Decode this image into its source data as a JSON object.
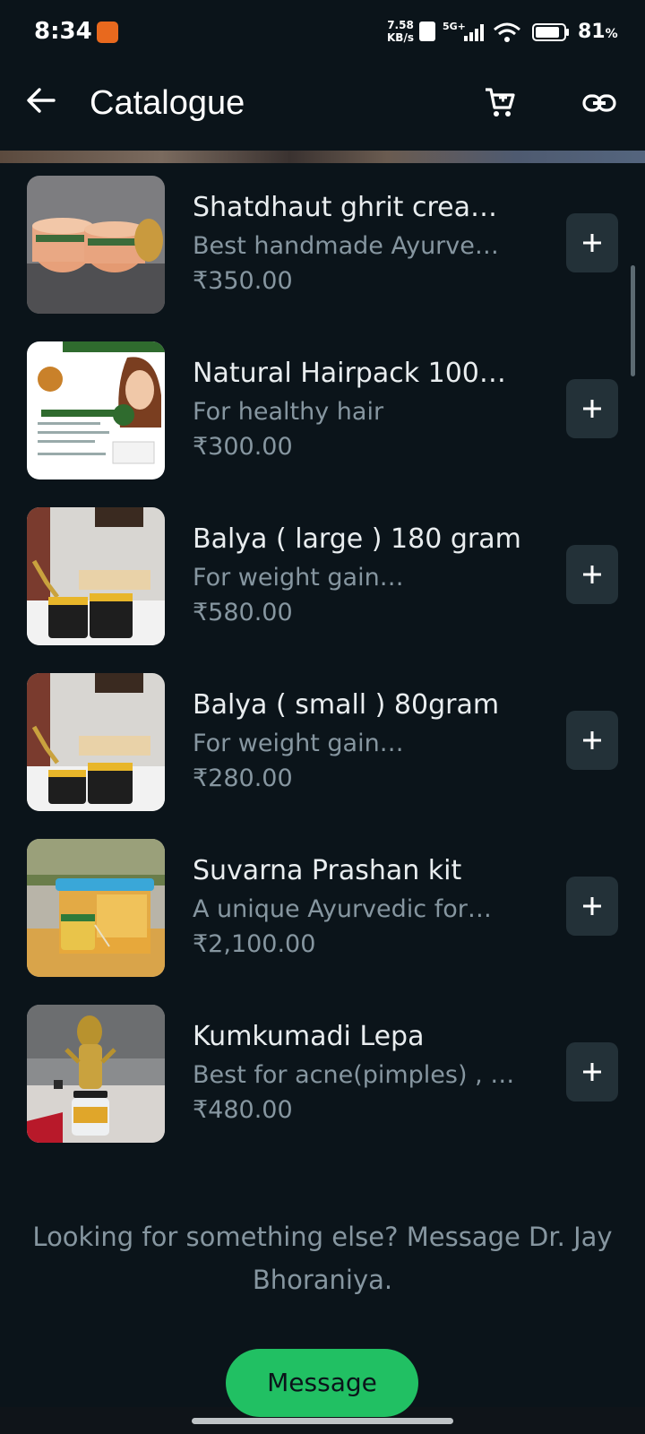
{
  "status_bar": {
    "time": "8:34",
    "net_speed_value": "7.58",
    "net_speed_unit": "KB/s",
    "network": "5G+",
    "battery_percent": "81",
    "battery_unit": "%"
  },
  "header": {
    "title": "Catalogue",
    "icons": [
      "back-arrow-icon",
      "cart-icon",
      "link-icon"
    ]
  },
  "products": [
    {
      "name": "Shatdhaut ghrit crea…",
      "description": "Best handmade Ayurve…",
      "price": "₹350.00",
      "add_label": "+"
    },
    {
      "name": "Natural Hairpack 100…",
      "description": "For healthy hair",
      "price": "₹300.00",
      "add_label": "+"
    },
    {
      "name": "Balya ( large ) 180 gram",
      "description": "For weight gain…",
      "price": "₹580.00",
      "add_label": "+"
    },
    {
      "name": "Balya ( small ) 80gram",
      "description": "For weight gain…",
      "price": "₹280.00",
      "add_label": "+"
    },
    {
      "name": "Suvarna Prashan kit",
      "description": "A unique Ayurvedic for…",
      "price": "₹2,100.00",
      "add_label": "+"
    },
    {
      "name": "Kumkumadi Lepa",
      "description": "Best for acne(pimples) , …",
      "price": "₹480.00",
      "add_label": "+"
    }
  ],
  "footer": {
    "prompt": "Looking for something else? Message Dr. Jay Bhoraniya.",
    "message_button": "Message"
  },
  "colors": {
    "background": "#0b141a",
    "accent": "#21c063",
    "secondary_text": "#8696a0",
    "add_button_bg": "#233138"
  }
}
